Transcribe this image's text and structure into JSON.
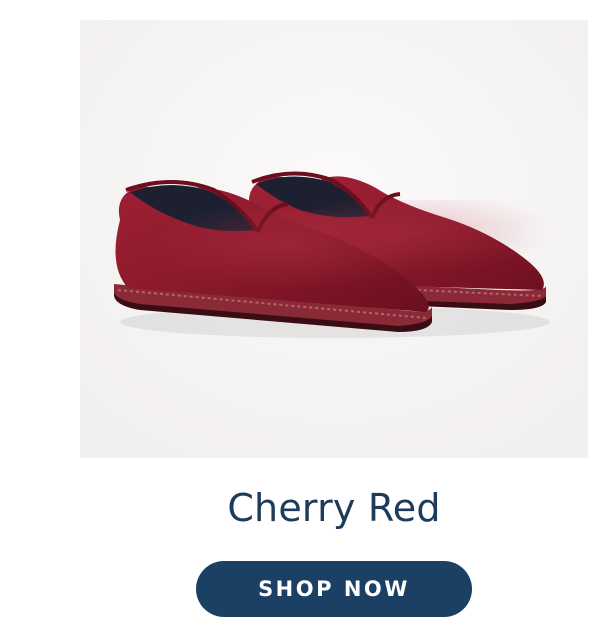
{
  "product": {
    "name": "Cherry Red",
    "image_subject": "slipper-shoes-icon",
    "colors": {
      "background": "#f6f3f3",
      "velvet": "#8f1a2c",
      "lining": "#1c2030",
      "title": "#1d3c5a",
      "button": "#1c3f64",
      "button_text": "#ffffff"
    }
  },
  "cta": {
    "label": "SHOP NOW"
  }
}
